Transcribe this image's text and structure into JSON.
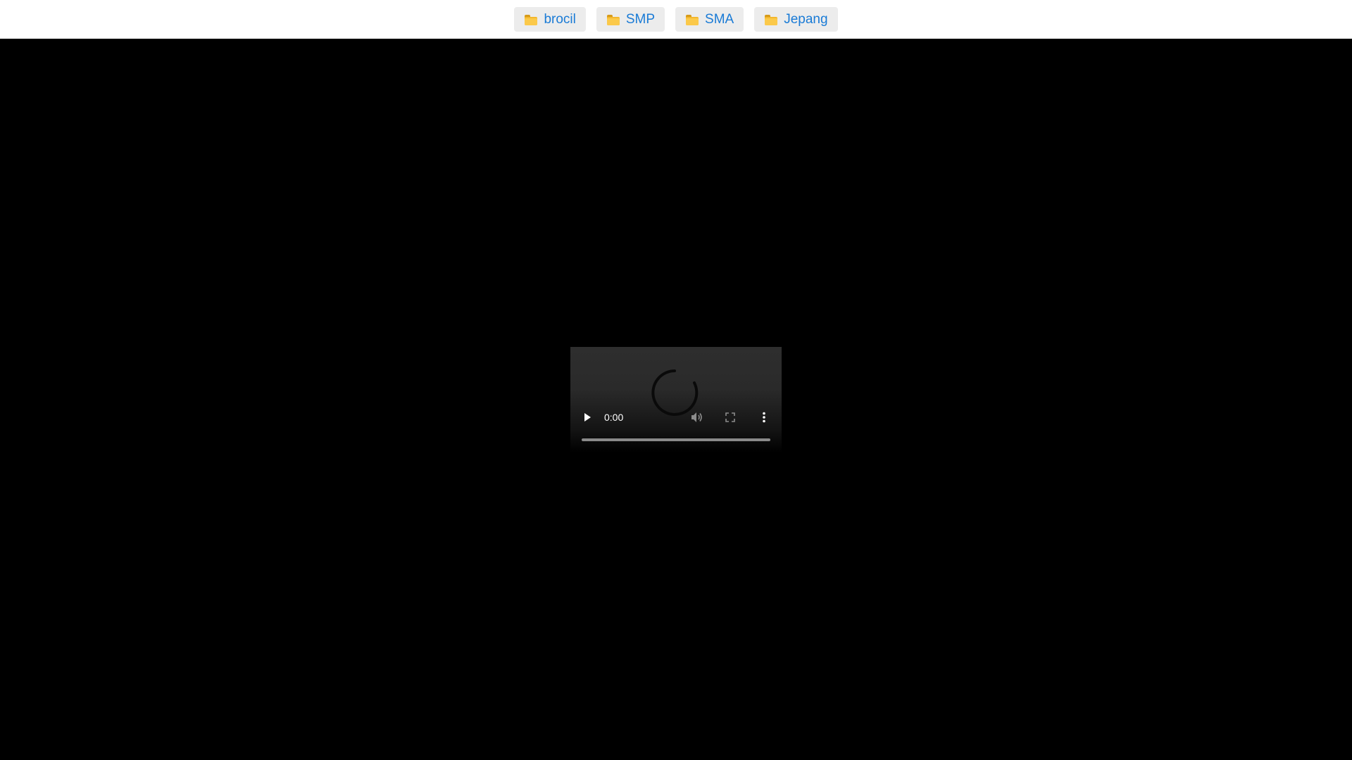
{
  "nav": {
    "folders": [
      {
        "label": "brocil",
        "icon": "folder-icon"
      },
      {
        "label": "SMP",
        "icon": "folder-icon"
      },
      {
        "label": "SMA",
        "icon": "folder-icon"
      },
      {
        "label": "Jepang",
        "icon": "folder-icon"
      }
    ],
    "accent_color": "#1a7bd6",
    "button_bg": "#ececec"
  },
  "player": {
    "current_time": "0:00",
    "progress": 0,
    "state": "loading",
    "controls": [
      "play-icon",
      "volume-icon",
      "fullscreen-icon",
      "more-options-icon"
    ]
  }
}
